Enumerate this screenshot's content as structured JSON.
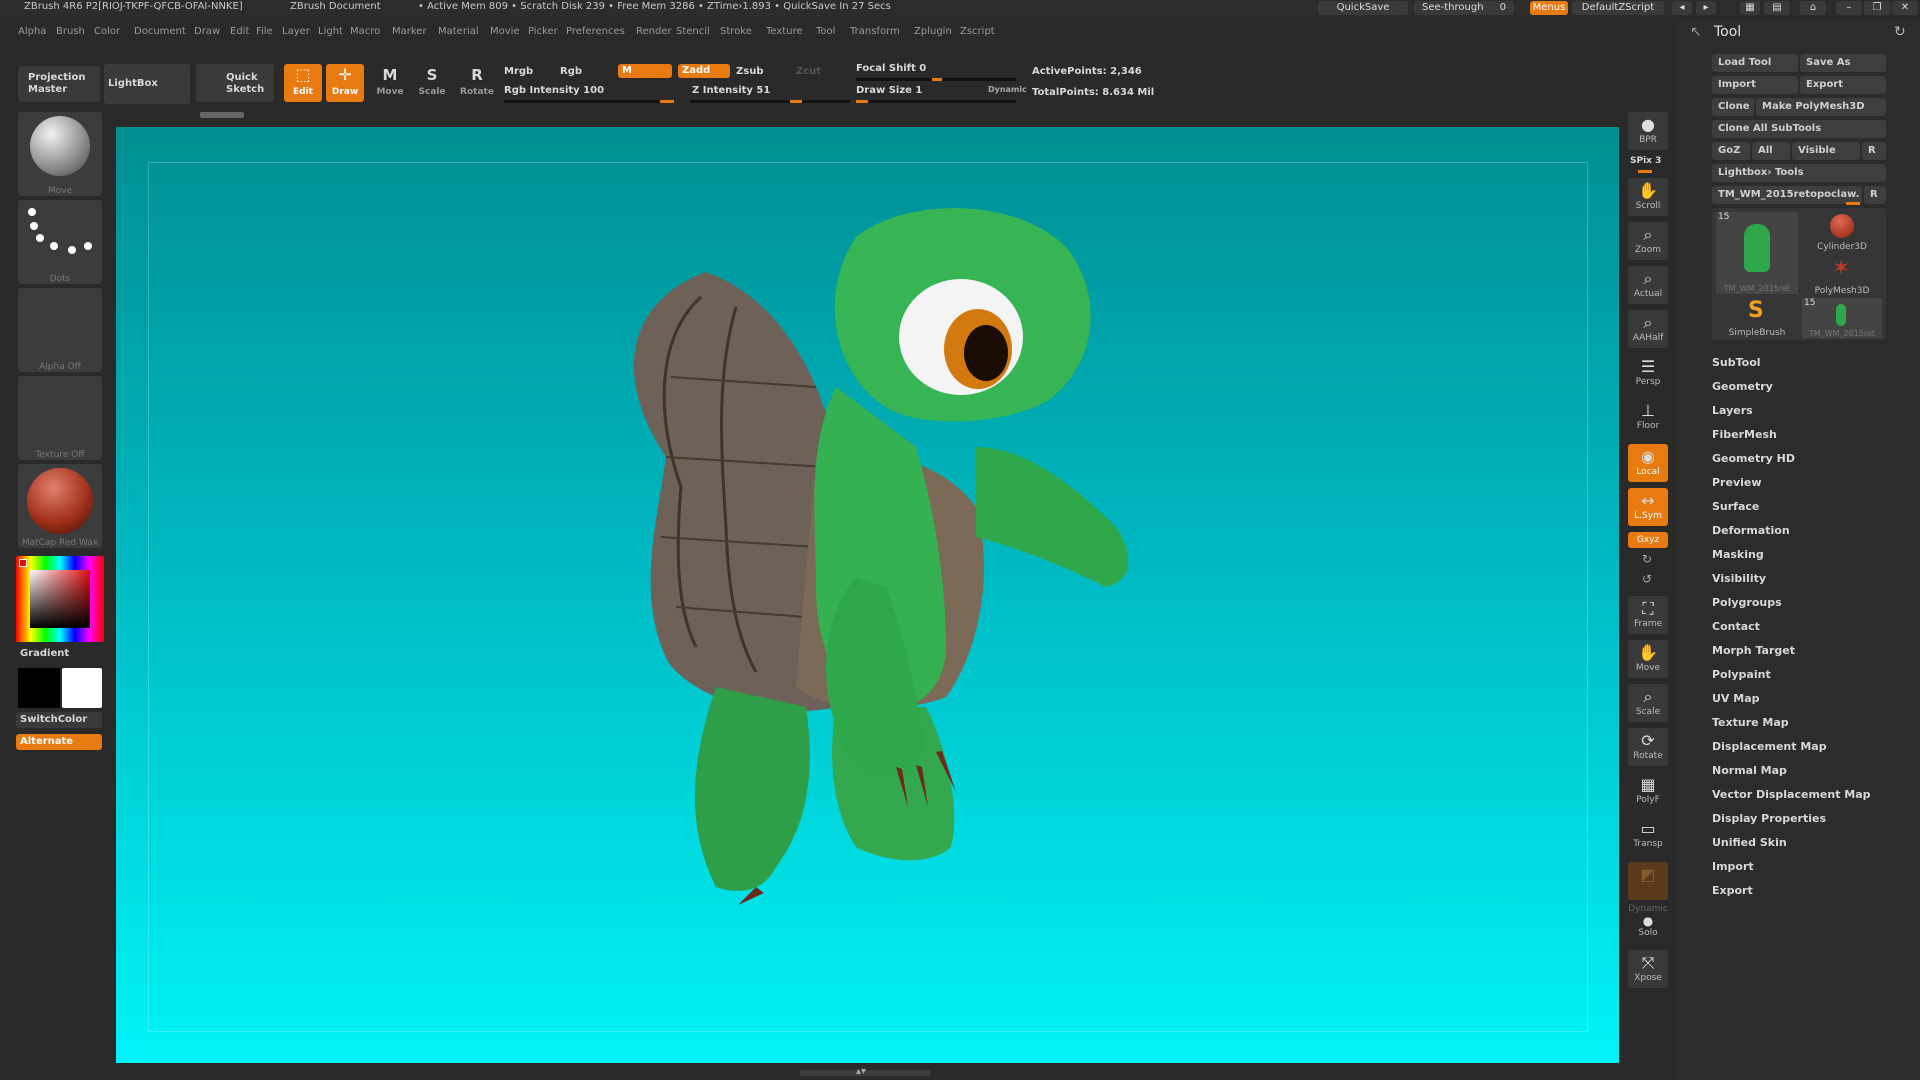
{
  "titlebar": {
    "app": "ZBrush 4R6 P2[RIOJ-TKPF-QFCB-OFAI-NNKE]",
    "document": "ZBrush Document",
    "status": "• Active Mem 809 • Scratch Disk 239 • Free Mem 3286 • ZTime›1.893 • QuickSave In 27 Secs",
    "quicksave": "QuickSave",
    "see_through_label": "See-through",
    "see_through_value": "0",
    "menus_label": "Menus",
    "zscript_label": "DefaultZScript"
  },
  "menubar": [
    "Alpha",
    "Brush",
    "Color",
    "Document",
    "Draw",
    "Edit",
    "File",
    "Layer",
    "Light",
    "Macro",
    "Marker",
    "Material",
    "Movie",
    "Picker",
    "Preferences",
    "Render",
    "Stencil",
    "Stroke",
    "Texture",
    "Tool",
    "Transform",
    "Zplugin",
    "Zscript"
  ],
  "shelf": {
    "projection_master": "Projection Master",
    "lightbox": "LightBox",
    "quick_sketch": "Quick Sketch",
    "edit": "Edit",
    "draw": "Draw",
    "move": "Move",
    "scale": "Scale",
    "rotate": "Rotate",
    "mrgb": "Mrgb",
    "rgb": "Rgb",
    "m": "M",
    "zadd": "Zadd",
    "zsub": "Zsub",
    "zcut": "Zcut",
    "rgb_intensity": "Rgb Intensity 100",
    "z_intensity": "Z Intensity 51",
    "focal_shift": "Focal Shift 0",
    "draw_size": "Draw Size 1",
    "dynamic": "Dynamic",
    "active_points": "ActivePoints: 2,346",
    "total_points": "TotalPoints: 8.634 Mil"
  },
  "left": {
    "brush": "Move",
    "stroke": "Dots",
    "alpha": "Alpha Off",
    "texture": "Texture Off",
    "material": "MatCap Red Wax",
    "gradient": "Gradient",
    "switch_color": "SwitchColor",
    "alternate": "Alternate"
  },
  "right_shelf": {
    "bpr": "BPR",
    "spix": "SPix 3",
    "scroll": "Scroll",
    "zoom": "Zoom",
    "actual": "Actual",
    "aahalf": "AAHalf",
    "persp": "Persp",
    "floor": "Floor",
    "local": "Local",
    "lsym": "L.Sym",
    "xyz": "Gxyz",
    "frame": "Frame",
    "move": "Move",
    "scale": "Scale",
    "rotate": "Rotate",
    "polyf": "PolyF",
    "transp": "Transp",
    "dynamic": "Dynamic",
    "solo": "Solo",
    "xpose": "Xpose"
  },
  "tool_panel": {
    "title": "Tool",
    "load_tool": "Load Tool",
    "save_as": "Save As",
    "import": "Import",
    "export": "Export",
    "clone": "Clone",
    "make_polymesh": "Make PolyMesh3D",
    "clone_all": "Clone All SubTools",
    "goz": "GoZ",
    "all": "All",
    "visible": "Visible",
    "r": "R",
    "lightbox_tools": "Lightbox› Tools",
    "current_tool": "TM_WM_2015retopoclaw.",
    "thumbs": [
      {
        "label": "TM_WM_2015ret",
        "count": "15"
      },
      {
        "label": "Cylinder3D",
        "count": ""
      },
      {
        "label": "PolyMesh3D",
        "count": ""
      },
      {
        "label": "SimpleBrush",
        "count": ""
      },
      {
        "label": "TM_WM_2015ret",
        "count": "15"
      }
    ],
    "items": [
      "SubTool",
      "Geometry",
      "Layers",
      "FiberMesh",
      "Geometry HD",
      "Preview",
      "Surface",
      "Deformation",
      "Masking",
      "Visibility",
      "Polygroups",
      "Contact",
      "Morph Target",
      "Polypaint",
      "UV Map",
      "Texture Map",
      "Displacement Map",
      "Normal Map",
      "Vector Displacement Map",
      "Display Properties",
      "Unified Skin",
      "Import",
      "Export"
    ]
  },
  "colors": {
    "accent": "#e87a10",
    "canvas_top": "#008f93",
    "canvas_bottom": "#00f4f8",
    "turtle_green": "#2fa84c"
  }
}
